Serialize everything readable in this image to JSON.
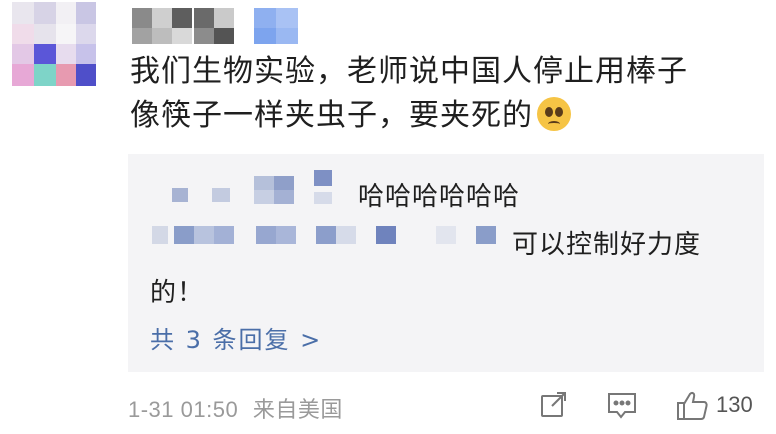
{
  "comment": {
    "line1": "我们生物实验，老师说中国人停止用棒子",
    "line2": "像筷子一样夹虫子，要夹死的",
    "emoji": "pleading-face-emoji"
  },
  "reply": {
    "line1_suffix": "哈哈哈哈哈哈",
    "line2_suffix": "可以控制好力度",
    "line3": "的！",
    "more_replies": "共 3 条回复 >"
  },
  "meta": {
    "timestamp": "1-31 01:50",
    "location": "来自美国"
  },
  "actions": {
    "like_count": "130",
    "share_icon": "share-icon",
    "comment_icon": "comment-icon",
    "like_icon": "thumbs-up-icon"
  }
}
